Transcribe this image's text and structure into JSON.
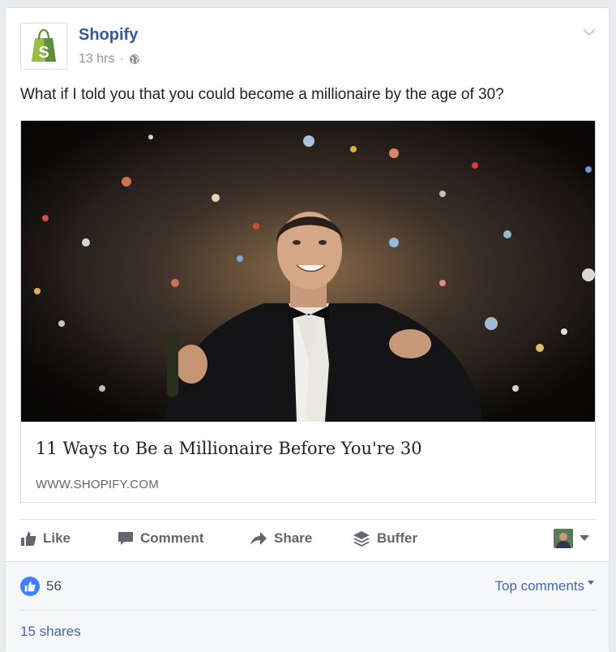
{
  "post": {
    "page_name": "Shopify",
    "timestamp": "13 hrs",
    "separator": "·",
    "privacy_icon": "globe-icon",
    "text": "What if I told you that you could become a millionaire by the age of 30?",
    "brand_color": "#95bf47"
  },
  "link": {
    "title": "11 Ways to Be a Millionaire Before You're 30",
    "domain": "WWW.SHOPIFY.COM"
  },
  "actions": {
    "like": "Like",
    "comment": "Comment",
    "share": "Share",
    "buffer": "Buffer"
  },
  "footer": {
    "like_count": "56",
    "top_comments": "Top comments",
    "shares": "15 shares"
  },
  "colors": {
    "link_blue": "#365899",
    "action_gray": "#616770",
    "like_blue": "#4080ff"
  }
}
